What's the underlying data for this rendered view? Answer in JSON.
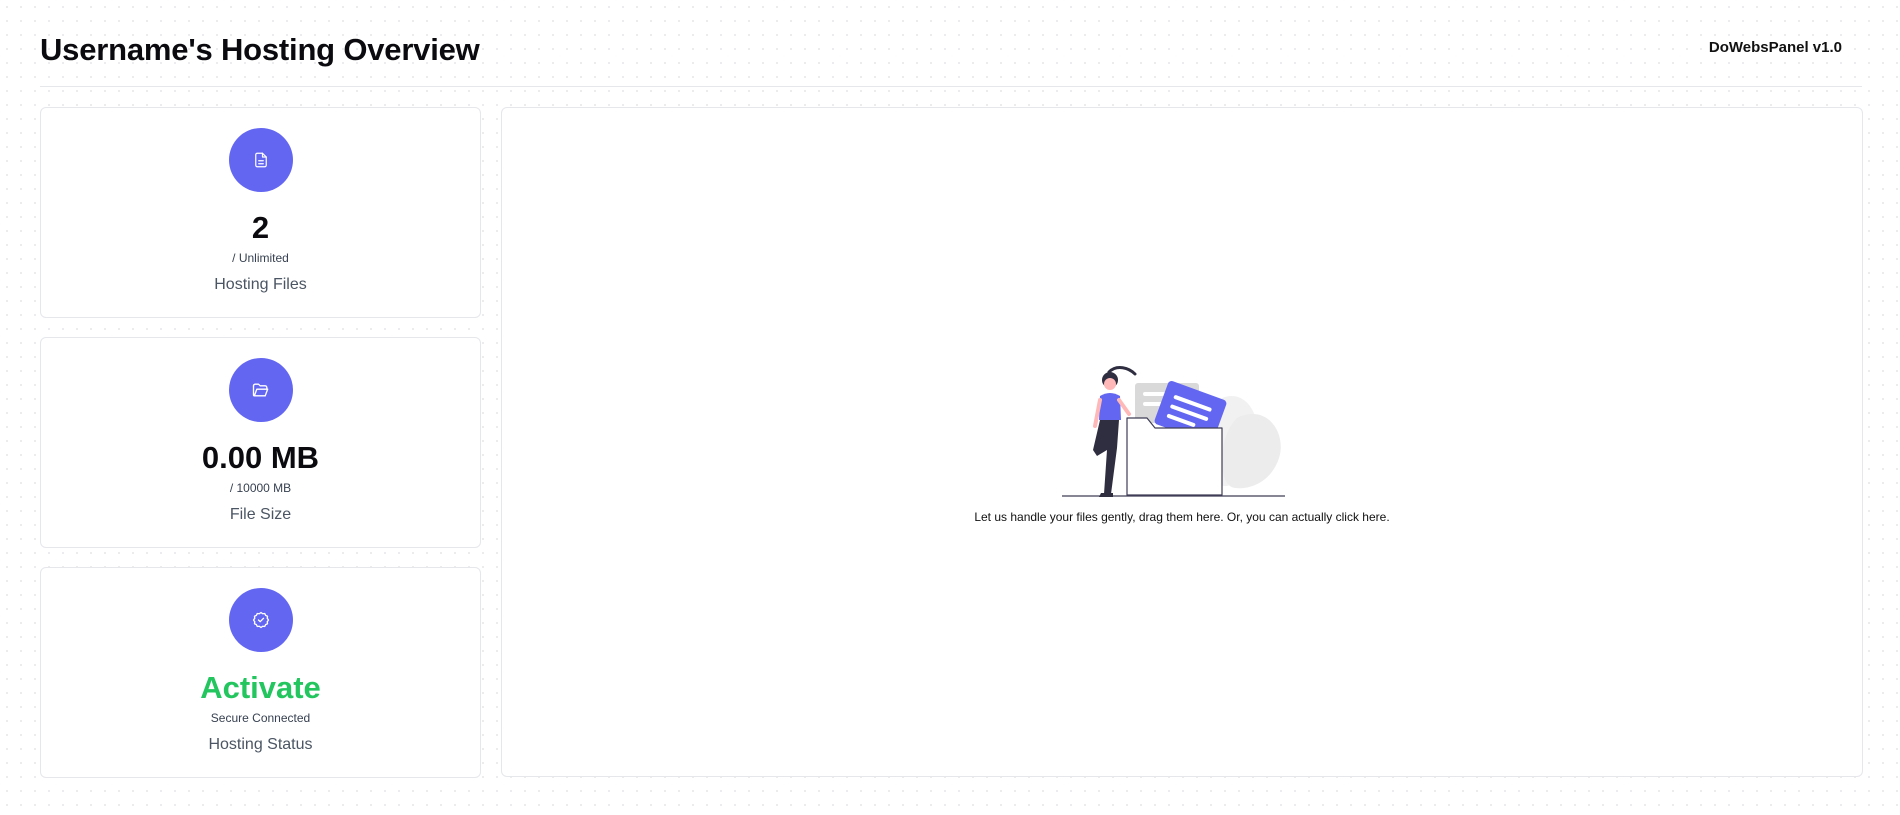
{
  "header": {
    "title": "Username's Hosting Overview",
    "brand": "DoWebsPanel v1.0"
  },
  "stats": [
    {
      "icon": "file-icon",
      "value": "2",
      "sub": "/ Unlimited",
      "label": "Hosting Files"
    },
    {
      "icon": "folder-open-icon",
      "value": "0.00 MB",
      "sub": "/ 10000 MB",
      "label": "File Size"
    },
    {
      "icon": "badge-check-icon",
      "value": "Activate",
      "sub": "Secure Connected",
      "label": "Hosting Status"
    }
  ],
  "dropzone": {
    "text": "Let us handle your files gently, drag them here. Or, you can actually click here."
  },
  "colors": {
    "accent": "#6366f1",
    "status_green": "#22c55e"
  }
}
